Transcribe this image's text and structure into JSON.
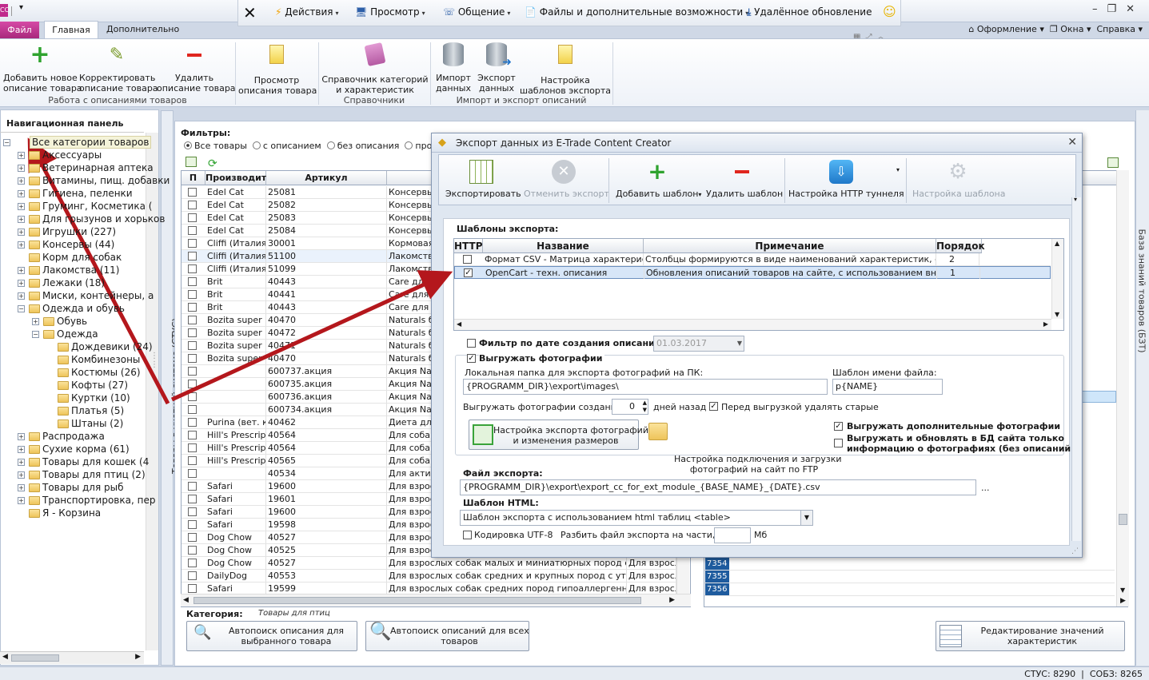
{
  "window": {
    "app_icon": "CC",
    "qat_arrow": "▾",
    "controls": [
      "–",
      "❐",
      "✕"
    ]
  },
  "topbar": {
    "items": [
      {
        "label": "Действия",
        "icon": "lightning-icon"
      },
      {
        "label": "Просмотр",
        "icon": "monitor-icon"
      },
      {
        "label": "Общение",
        "icon": "phone-icon"
      },
      {
        "label": "Файлы и дополнительные возможности",
        "icon": "document-icon"
      },
      {
        "label": "Удалённое обновление",
        "icon": "download-icon"
      }
    ]
  },
  "tabs": {
    "file": "Файл",
    "main": "Главная",
    "extra": "Дополнительно"
  },
  "rightmenu": {
    "design": "Оформление",
    "windows": "Окна",
    "help": "Справка"
  },
  "ribbon": {
    "buttons": [
      {
        "label": "Добавить новое\nописание товара"
      },
      {
        "label": "Корректировать\nописание товара"
      },
      {
        "label": "Удалить\nописание товара"
      },
      {
        "label": "Просмотр\nописания товара"
      },
      {
        "label": "Справочник категорий\nи характеристик"
      },
      {
        "label": "Импорт\nданных"
      },
      {
        "label": "Экспорт\nданных"
      },
      {
        "label": "Настройка\nшаблонов экспорта"
      }
    ],
    "groups": [
      "Работа с описаниями товаров",
      "Справочники",
      "Импорт и экспорт описаний"
    ]
  },
  "nav": {
    "title": "Навигационная панель",
    "tree": [
      {
        "label": "Все категории товаров",
        "level": 0
      },
      {
        "label": "Аксессуары",
        "level": 1
      },
      {
        "label": "Ветеринарная аптека",
        "level": 1
      },
      {
        "label": "Витамины, пищ. добавки",
        "level": 1
      },
      {
        "label": "Гигиена, пеленки",
        "level": 1
      },
      {
        "label": "Груминг, Косметика (",
        "level": 1
      },
      {
        "label": "Для грызунов и хорьков",
        "level": 1
      },
      {
        "label": "Игрушки (227)",
        "level": 1
      },
      {
        "label": "Консервы (44)",
        "level": 1
      },
      {
        "label": "Корм для собак",
        "level": 1
      },
      {
        "label": "Лакомства (11)",
        "level": 1
      },
      {
        "label": "Лежаки (18)",
        "level": 1
      },
      {
        "label": "Миски, контейнеры, а",
        "level": 1
      },
      {
        "label": "Одежда и обувь",
        "level": 1
      },
      {
        "label": "Обувь",
        "level": 2
      },
      {
        "label": "Одежда",
        "level": 2
      },
      {
        "label": "Дождевики (24)",
        "level": 3
      },
      {
        "label": "Комбинезоны",
        "level": 3
      },
      {
        "label": "Костюмы (26)",
        "level": 3
      },
      {
        "label": "Кофты (27)",
        "level": 3
      },
      {
        "label": "Куртки (10)",
        "level": 3
      },
      {
        "label": "Платья (5)",
        "level": 3
      },
      {
        "label": "Штаны (2)",
        "level": 3
      },
      {
        "label": "Распродажа",
        "level": 1
      },
      {
        "label": "Сухие корма (61)",
        "level": 1
      },
      {
        "label": "Товары для кошек (4",
        "level": 1
      },
      {
        "label": "Товары для птиц (2)",
        "level": 1
      },
      {
        "label": "Товары для рыб",
        "level": 1
      },
      {
        "label": "Транспортировка, пер",
        "level": 1
      },
      {
        "label": "Я - Корзина",
        "level": 1
      }
    ]
  },
  "side_labels": {
    "left": "Товары в учетной системе (СТУС)",
    "right": "База знаний товаров (БЗТ)"
  },
  "filters": {
    "title": "Фильтры:",
    "options": [
      "Все товары",
      "с описанием",
      "без описания",
      "провер"
    ],
    "selected": 0
  },
  "grid": {
    "headers": [
      "П",
      "Производитель",
      "Артикул",
      ""
    ],
    "rows": [
      [
        "Edel Cat",
        "25081",
        "Консервы"
      ],
      [
        "Edel Cat",
        "25082",
        "Консервы"
      ],
      [
        "Edel Cat",
        "25083",
        "Консервы"
      ],
      [
        "Edel Cat",
        "25084",
        "Консервы"
      ],
      [
        "Cliffi (Италия)",
        "30001",
        "Кормовая"
      ],
      [
        "Cliffi (Италия)",
        "51100",
        "Лакомства"
      ],
      [
        "Cliffi (Италия)",
        "51099",
        "Лакомства"
      ],
      [
        "Brit",
        "40443",
        "Care для"
      ],
      [
        "Brit",
        "40441",
        "Care для"
      ],
      [
        "Brit",
        "40443",
        "Care для"
      ],
      [
        "Bozita super premium",
        "40470",
        "Naturals бе"
      ],
      [
        "Bozita super premium",
        "40472",
        "Naturals бе"
      ],
      [
        "Bozita super premium",
        "40471",
        "Naturals бе"
      ],
      [
        "Bozita super premium",
        "40470",
        "Naturals бе"
      ],
      [
        "",
        "600737.акция",
        "Акция Nat"
      ],
      [
        "",
        "600735.акция",
        "Акция Nat"
      ],
      [
        "",
        "600736.акция",
        "Акция Nat"
      ],
      [
        "",
        "600734.акция",
        "Акция Nat"
      ],
      [
        "Purina (вет. корма)",
        "40462",
        "Диета для"
      ],
      [
        "Hill's Prescription",
        "40564",
        "Для собак"
      ],
      [
        "Hill's Prescription",
        "40564",
        "Для собак"
      ],
      [
        "Hill's Prescription",
        "40565",
        "Для собак"
      ],
      [
        "",
        "40534",
        "Для актив"
      ],
      [
        "Safari",
        "19600",
        "Для взросл"
      ],
      [
        "Safari",
        "19601",
        "Для взросл"
      ],
      [
        "Safari",
        "19600",
        "Для взросл"
      ],
      [
        "Safari",
        "19598",
        "Для взросл"
      ],
      [
        "Dog Chow",
        "40527",
        "Для взросл"
      ],
      [
        "Dog Chow",
        "40525",
        "Для взросл"
      ],
      [
        "Dog Chow",
        "40527",
        "Для взрослых собак малых и миниатюрных пород с курицей"
      ],
      [
        "DailyDog",
        "40553",
        "Для взрослых собак средних и крупных пород с уткой и овсом"
      ],
      [
        "Safari",
        "19599",
        "Для взрослых собак средних пород гипоаллергенный с утко"
      ]
    ],
    "extra_col": [
      "Для взросль",
      "Для взросль",
      "Для взросль"
    ]
  },
  "right_grid": {
    "rows": [
      "7354",
      "7355",
      "7356"
    ]
  },
  "bottom": {
    "category_label": "Категория:",
    "category_value": "Товары для птиц",
    "btn_autosearch_selected": "Автопоиск описания для\nвыбранного товара",
    "btn_autosearch_all": "Автопоиск описаний для всех\nтоваров",
    "btn_edit_values": "Редактирование значений\nхарактеристик"
  },
  "status": {
    "stus": "СТУС: 8290",
    "sobz": "СОБЗ: 8265"
  },
  "dialog": {
    "title": "Экспорт данных из E-Trade Content Creator",
    "toolbar": {
      "export": "Экспортировать",
      "cancel_export": "Отменить экспорт",
      "add_template": "Добавить шаблон",
      "delete_template": "Удалить шаблон",
      "http_tunnel": "Настройка HTTP туннеля",
      "template_settings": "Настройка шаблона"
    },
    "templates_title": "Шаблоны экспорта:",
    "templates_headers": [
      "HTTP",
      "Название",
      "Примечание",
      "Порядок"
    ],
    "templates": [
      {
        "http": false,
        "name": "Формат CSV - Матрица характеристик",
        "note": "Столбцы формируются в виде наименований характеристик, строки",
        "order": "2"
      },
      {
        "http": true,
        "name": "OpenCart - техн. описания",
        "note": "Обновления описаний товаров на сайте, с использованием внешнего",
        "order": "1"
      }
    ],
    "filter_date_label": "Фильтр по дате создания описаний",
    "filter_date_value": "01.03.2017",
    "export_photos_label": "Выгружать фотографии",
    "local_folder_label": "Локальная папка для экспорта фотографий на ПК:",
    "local_folder_value": "{PROGRAMM_DIR}\\export\\images\\",
    "filename_template_label": "Шаблон имени файла:",
    "filename_template_value": "p{NAME}",
    "photos_created_label": "Выгружать фотографии созданные",
    "photos_days_value": "0",
    "days_ago_label": "дней назад",
    "delete_old_label": "Перед выгрузкой удалять старые",
    "photo_settings_btn": "Настройка экспорта фотографий\nи изменения размеров",
    "ftp_settings": "Настройка подключения и загрузки\nфотографий на сайт по FTP",
    "extra_photos_label": "Выгружать дополнительные фотографии",
    "photos_only_label": "Выгружать и обновлять в БД сайта только\nинформацию о фотографиях (без описаний)",
    "export_file_label": "Файл экспорта:",
    "export_file_value": "{PROGRAMM_DIR}\\export\\export_cc_for_ext_module_{BASE_NAME}_{DATE}.csv",
    "browse": "...",
    "html_template_label": "Шаблон HTML:",
    "html_template_value": "Шаблон экспорта с использованием html таблиц <table>",
    "utf8_label": "Кодировка UTF-8",
    "split_label": "Разбить файл экспорта на части, по:",
    "split_value": "",
    "mb": "Мб"
  },
  "colors": {
    "accent": "#c02a8c",
    "arrow": "#b4171c",
    "selected_row": "#d7e6f8",
    "rownum": "#1e5b9e"
  }
}
